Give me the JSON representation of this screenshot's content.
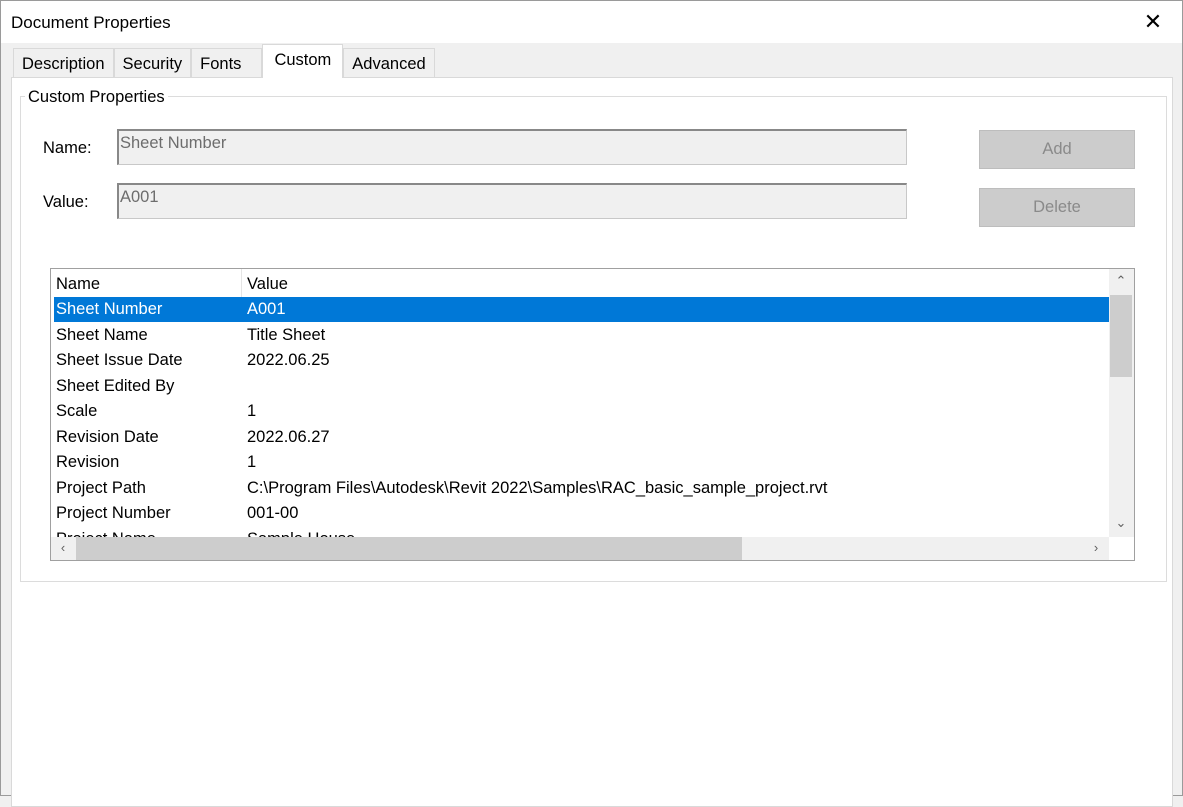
{
  "window": {
    "title": "Document Properties",
    "close_icon": "close-icon"
  },
  "tabs": [
    {
      "label": "Description"
    },
    {
      "label": "Security"
    },
    {
      "label": "Fonts"
    },
    {
      "label": "Custom",
      "active": true
    },
    {
      "label": "Advanced"
    }
  ],
  "custom": {
    "group_label": "Custom Properties",
    "name_label": "Name:",
    "name_value": "Sheet Number",
    "value_label": "Value:",
    "value_value": "A001",
    "add_label": "Add",
    "delete_label": "Delete",
    "columns": [
      "Name",
      "Value"
    ],
    "rows": [
      {
        "name": "Sheet Number",
        "value": "A001",
        "selected": true
      },
      {
        "name": "Sheet Name",
        "value": "Title Sheet"
      },
      {
        "name": "Sheet Issue Date",
        "value": "2022.06.25"
      },
      {
        "name": "Sheet Edited By",
        "value": ""
      },
      {
        "name": "Scale",
        "value": "1"
      },
      {
        "name": "Revision Date",
        "value": "2022.06.27"
      },
      {
        "name": "Revision",
        "value": "1"
      },
      {
        "name": "Project Path",
        "value": "C:\\Program Files\\Autodesk\\Revit 2022\\Samples\\RAC_basic_sample_project.rvt"
      },
      {
        "name": "Project Number",
        "value": "001-00"
      },
      {
        "name": "Project Name",
        "value": "Sample House"
      }
    ],
    "selection_color": "#0078d7"
  }
}
